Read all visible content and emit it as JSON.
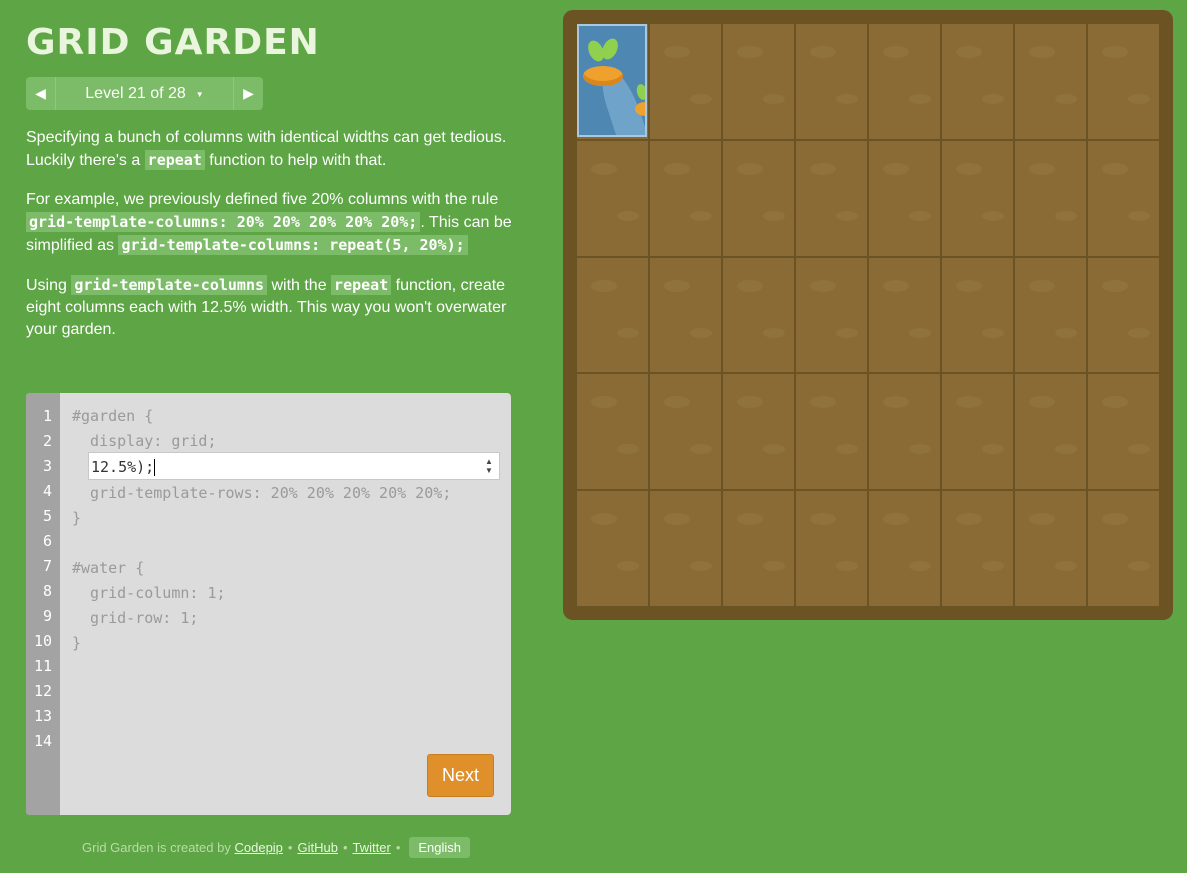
{
  "header": {
    "title": "GRID GARDEN",
    "level_label": "Level 21 of 28"
  },
  "icons": {
    "prev": "triangle-left",
    "next": "triangle-right",
    "level_dropdown": "caret-down"
  },
  "instructions": {
    "p1_a": "Specifying a bunch of columns with identical widths can get tedious. Luckily there's a ",
    "p1_code": "repeat",
    "p1_b": " function to help with that.",
    "p2_a": "For example, we previously defined five 20% columns with the rule ",
    "p2_code1": "grid-template-columns: 20% 20% 20% 20% 20%;",
    "p2_b": ". This can be simplified as ",
    "p2_code2": "grid-template-columns: repeat(5, 20%);",
    "p3_a": "Using ",
    "p3_code1": "grid-template-columns",
    "p3_b": " with the ",
    "p3_code2": "repeat",
    "p3_c": " function, create eight columns each with 12.5% width. This way you won't overwater your garden."
  },
  "editor": {
    "line_numbers": [
      "1",
      "2",
      "3",
      "4",
      "5",
      "6",
      "7",
      "8",
      "9",
      "10",
      "11",
      "12",
      "13",
      "14"
    ],
    "line1": "#garden {",
    "line2": "  display: grid;",
    "line4": "  grid-template-rows: 20% 20% 20% 20% 20%;",
    "line5": "}",
    "line7": "#water {",
    "line8": "  grid-column: 1;",
    "line9": "  grid-row: 1;",
    "line10": "}",
    "input_value": "12.5%);",
    "next_label": "Next"
  },
  "footer": {
    "prefix": "Grid Garden is created by",
    "codepip": "Codepip",
    "github": "GitHub",
    "twitter": "Twitter",
    "language": "English",
    "separator": "•"
  },
  "garden": {
    "columns": 8,
    "rows": 5,
    "water_cell": {
      "column": 1,
      "row": 1
    }
  },
  "colors": {
    "background": "#5da545",
    "accent": "#7cbb67",
    "next_button": "#e0902a",
    "soil": "#8a6b35",
    "garden_border": "#6b5324",
    "water": "#4f87b3"
  }
}
